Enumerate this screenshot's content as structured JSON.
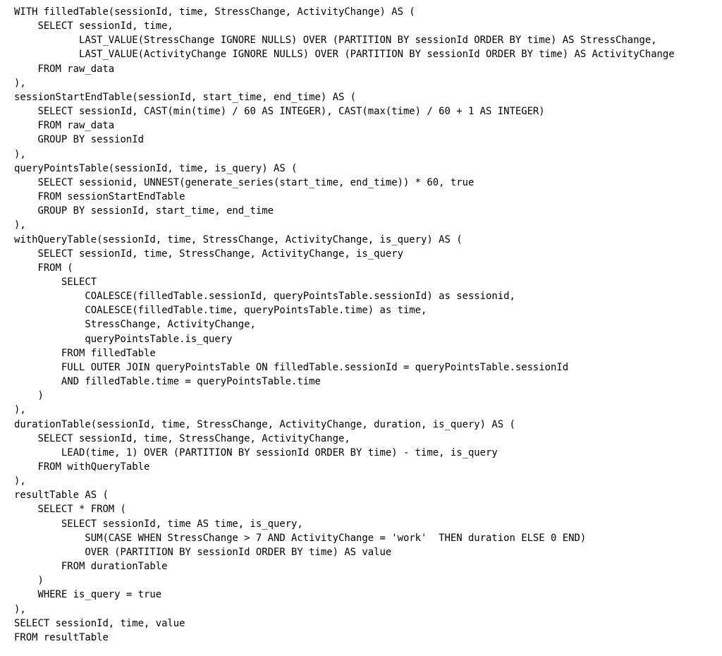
{
  "document": {
    "kind": "sql-source-listing",
    "language": "SQL",
    "background_color": "#ffffff",
    "text_color": "#000000",
    "line_count": 46,
    "code_lines": [
      "WITH filledTable(sessionId, time, StressChange, ActivityChange) AS (",
      "    SELECT sessionId, time,",
      "           LAST_VALUE(StressChange IGNORE NULLS) OVER (PARTITION BY sessionId ORDER BY time) AS StressChange,",
      "           LAST_VALUE(ActivityChange IGNORE NULLS) OVER (PARTITION BY sessionId ORDER BY time) AS ActivityChange",
      "    FROM raw_data",
      "),",
      "sessionStartEndTable(sessionId, start_time, end_time) AS (",
      "    SELECT sessionId, CAST(min(time) / 60 AS INTEGER), CAST(max(time) / 60 + 1 AS INTEGER)",
      "    FROM raw_data",
      "    GROUP BY sessionId",
      "),",
      "queryPointsTable(sessionId, time, is_query) AS (",
      "    SELECT sessionid, UNNEST(generate_series(start_time, end_time)) * 60, true",
      "    FROM sessionStartEndTable",
      "    GROUP BY sessionId, start_time, end_time",
      "),",
      "withQueryTable(sessionId, time, StressChange, ActivityChange, is_query) AS (",
      "    SELECT sessionId, time, StressChange, ActivityChange, is_query",
      "    FROM (",
      "        SELECT",
      "            COALESCE(filledTable.sessionId, queryPointsTable.sessionId) as sessionid,",
      "            COALESCE(filledTable.time, queryPointsTable.time) as time,",
      "            StressChange, ActivityChange,",
      "            queryPointsTable.is_query",
      "        FROM filledTable",
      "        FULL OUTER JOIN queryPointsTable ON filledTable.sessionId = queryPointsTable.sessionId",
      "        AND filledTable.time = queryPointsTable.time",
      "    )",
      "),",
      "durationTable(sessionId, time, StressChange, ActivityChange, duration, is_query) AS (",
      "    SELECT sessionId, time, StressChange, ActivityChange,",
      "        LEAD(time, 1) OVER (PARTITION BY sessionId ORDER BY time) - time, is_query",
      "    FROM withQueryTable",
      "),",
      "resultTable AS (",
      "    SELECT * FROM (",
      "        SELECT sessionId, time AS time, is_query,",
      "            SUM(CASE WHEN StressChange > 7 AND ActivityChange = 'work'  THEN duration ELSE 0 END)",
      "            OVER (PARTITION BY sessionId ORDER BY time) AS value",
      "        FROM durationTable",
      "    )",
      "    WHERE is_query = true",
      "),",
      "SELECT sessionId, time, value",
      "FROM resultTable",
      ""
    ]
  }
}
